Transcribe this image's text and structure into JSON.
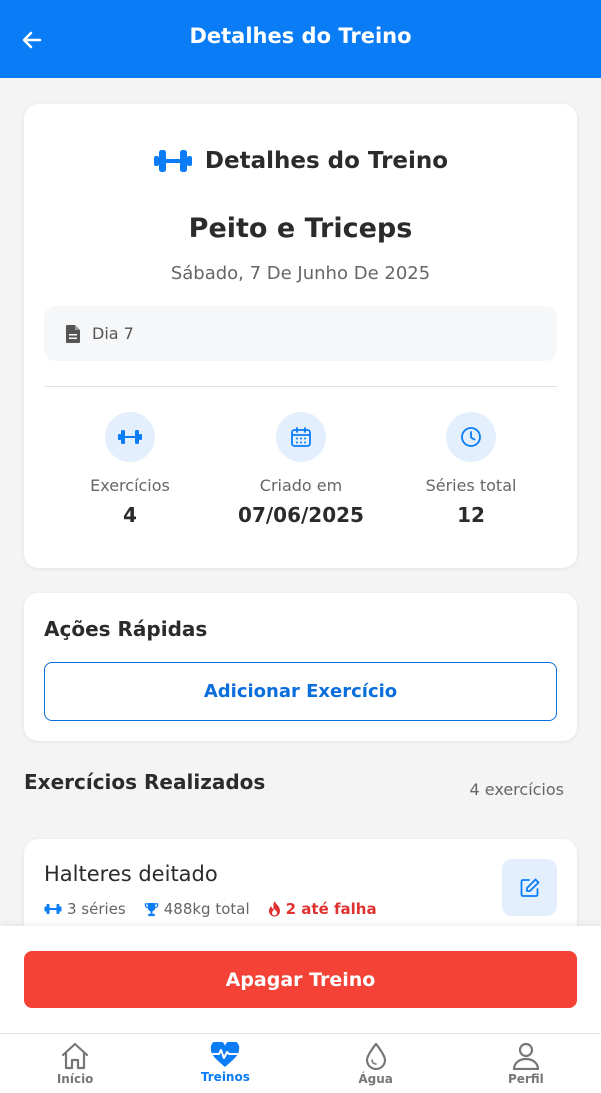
{
  "header": {
    "title": "Detalhes do Treino"
  },
  "summary": {
    "card_title": "Detalhes do Treino",
    "workout_name": "Peito e Triceps",
    "date": "Sábado, 7 De Junho De 2025",
    "note": "Dia 7",
    "stats": [
      {
        "label": "Exercícios",
        "value": "4",
        "icon": "dumbbell-icon"
      },
      {
        "label": "Criado em",
        "value": "07/06/2025",
        "icon": "calendar-icon"
      },
      {
        "label": "Séries total",
        "value": "12",
        "icon": "clock-icon"
      }
    ]
  },
  "quick_actions": {
    "title": "Ações Rápidas",
    "add_exercise_label": "Adicionar Exercício"
  },
  "exercises_section": {
    "title": "Exercícios Realizados",
    "count_label": "4 exercícios",
    "items": [
      {
        "name": "Halteres deitado",
        "sets": "3 séries",
        "total": "488kg total",
        "failure": "2 até falha"
      }
    ]
  },
  "delete_label": "Apagar Treino",
  "tabs": [
    {
      "label": "Início",
      "icon": "home-icon",
      "active": false
    },
    {
      "label": "Treinos",
      "icon": "heart-pulse-icon",
      "active": true
    },
    {
      "label": "Água",
      "icon": "water-drop-icon",
      "active": false
    },
    {
      "label": "Perfil",
      "icon": "user-icon",
      "active": false
    }
  ],
  "colors": {
    "primary": "#0a7cf5",
    "danger": "#f44336",
    "failure_text": "#e03131",
    "icon_bg": "#e3effd"
  }
}
